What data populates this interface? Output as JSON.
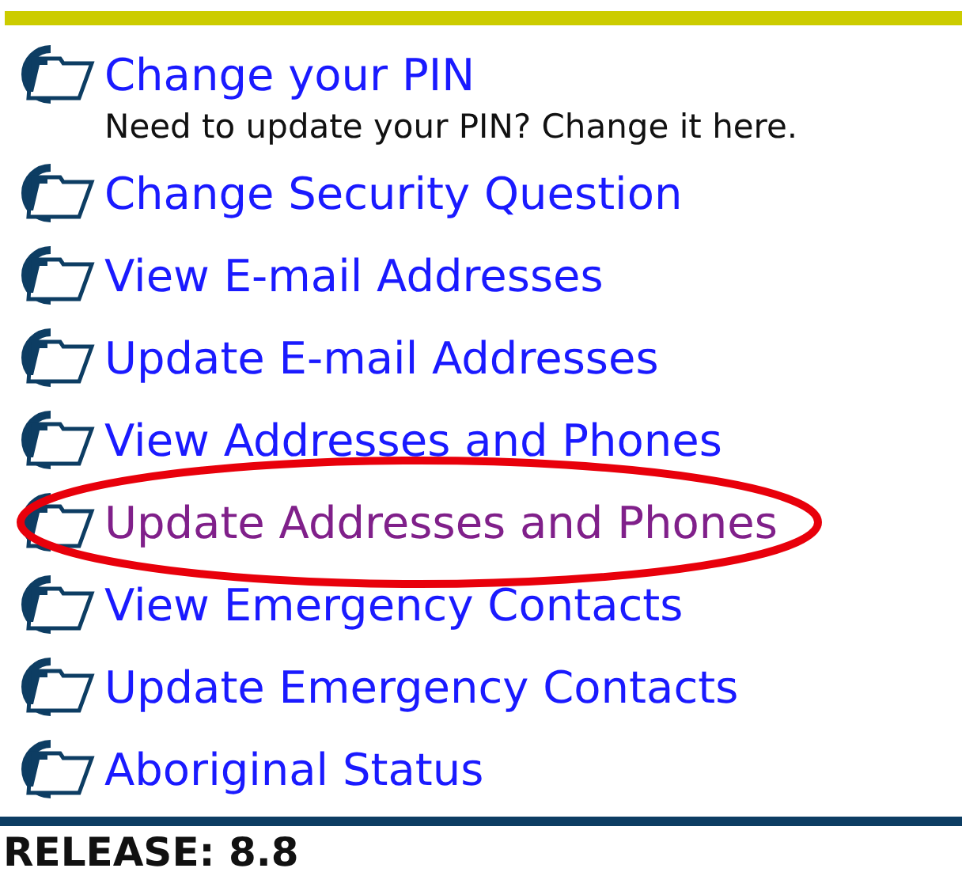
{
  "menu": [
    {
      "label": "Change your PIN",
      "description": "Need to update your PIN? Change it here.",
      "visited": false,
      "highlighted": false
    },
    {
      "label": "Change Security Question",
      "visited": false,
      "highlighted": false
    },
    {
      "label": "View E-mail Addresses",
      "visited": false,
      "highlighted": false
    },
    {
      "label": "Update E-mail Addresses",
      "visited": false,
      "highlighted": false
    },
    {
      "label": "View Addresses and Phones",
      "visited": false,
      "highlighted": false
    },
    {
      "label": "Update Addresses and Phones",
      "visited": true,
      "highlighted": true
    },
    {
      "label": "View Emergency Contacts",
      "visited": false,
      "highlighted": false
    },
    {
      "label": "Update Emergency Contacts",
      "visited": false,
      "highlighted": false
    },
    {
      "label": "Aboriginal Status",
      "visited": false,
      "highlighted": false
    }
  ],
  "release": "RELEASE: 8.8"
}
